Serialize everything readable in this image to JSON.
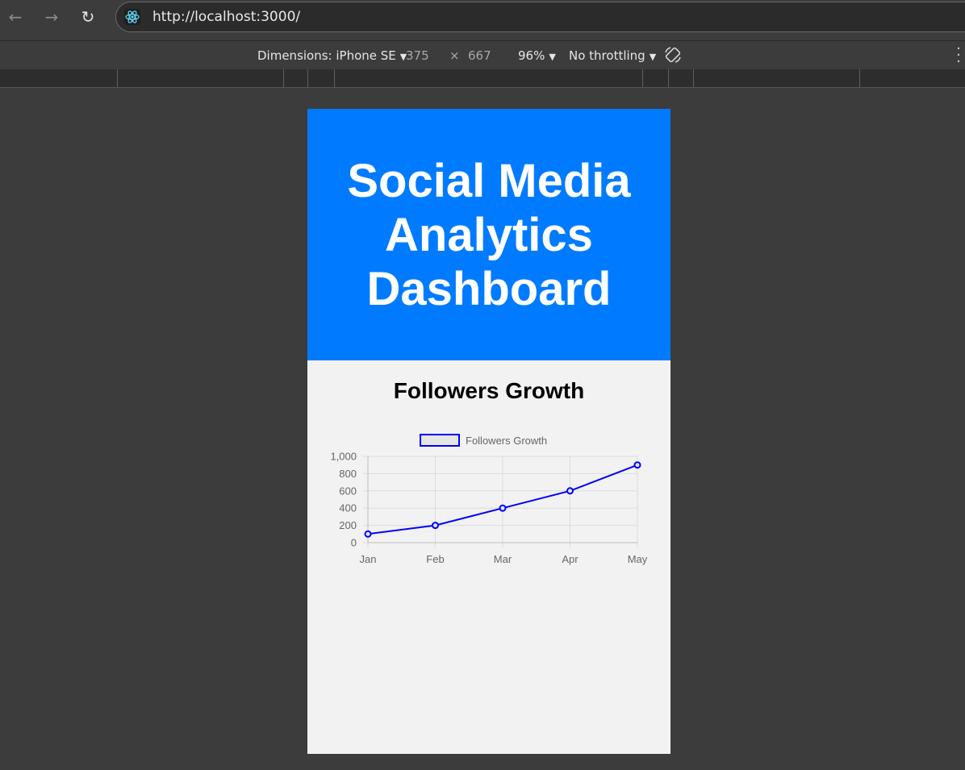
{
  "browser": {
    "url": "http://localhost:3000/"
  },
  "device_toolbar": {
    "dimensions_label": "Dimensions: iPhone SE",
    "width": "375",
    "times": "×",
    "height": "667",
    "zoom": "96%",
    "throttling": "No throttling"
  },
  "page": {
    "title": "Social Media Analytics Dashboard",
    "section_title": "Followers Growth"
  },
  "colors": {
    "header_bg": "#007bff",
    "line": "#0000ff"
  },
  "chart_data": {
    "type": "line",
    "categories": [
      "Jan",
      "Feb",
      "Mar",
      "Apr",
      "May"
    ],
    "series": [
      {
        "name": "Followers Growth",
        "values": [
          100,
          200,
          400,
          600,
          900
        ]
      }
    ],
    "y_ticks": [
      "1,000",
      "800",
      "600",
      "400",
      "200",
      "0"
    ],
    "ylim": [
      0,
      1000
    ],
    "grid": true,
    "legend": "top-center"
  }
}
